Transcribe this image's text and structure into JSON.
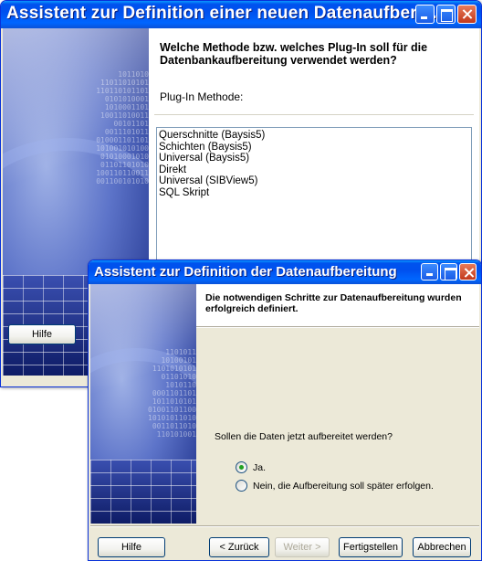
{
  "colors": {
    "title_bar": "#0054e3",
    "dialog_face": "#ece9d8",
    "close_button": "#c2381b",
    "radio_dot": "#21a121"
  },
  "back_window": {
    "title": "Assistent zur Definition einer neuen Datenaufbere...",
    "controls": [
      "minimize-icon",
      "maximize-icon",
      "close-icon"
    ],
    "header": "Welche Methode bzw. welches Plug-In soll für die Datenbankaufbereitung verwendet werden?",
    "plugin_label": "Plug-In Methode:",
    "plugin_list": [
      "Querschnitte (Baysis5)",
      "Schichten (Baysis5)",
      "Universal (Baysis5)",
      "Direkt",
      "Universal (SIBView5)",
      "SQL Skript"
    ],
    "help_button": "Hilfe",
    "binary_art": [
      "1011010",
      "11011010101",
      "110110101101",
      "0101010001",
      "1010001101",
      "10011010011",
      "00101101",
      "0011101011",
      "010001101101",
      "101001010100",
      "01010001010",
      "01101101010",
      "100110110011",
      "001100101010"
    ]
  },
  "front_window": {
    "title": "Assistent zur Definition der Datenaufbereitung",
    "controls": [
      "minimize-icon",
      "maximize-icon",
      "close-icon"
    ],
    "header": "Die notwendigen Schritte zur Datenaufbereitung wurden erfolgreich definiert.",
    "question": "Sollen die Daten jetzt aufbereitet werden?",
    "options": [
      {
        "label": "Ja.",
        "selected": true
      },
      {
        "label": "Nein, die Aufbereitung soll später erfolgen.",
        "selected": false
      }
    ],
    "buttons": {
      "help": "Hilfe",
      "back": "< Zurück",
      "next": "Weiter >",
      "finish": "Fertigstellen",
      "cancel": "Abbrechen"
    },
    "binary_art": [
      "1101011",
      "10100101",
      "1101010101",
      "01101010",
      "1010110",
      "0001101101",
      "1011010101",
      "01001101100",
      "10101011010",
      "0011011010",
      "110101001"
    ]
  }
}
